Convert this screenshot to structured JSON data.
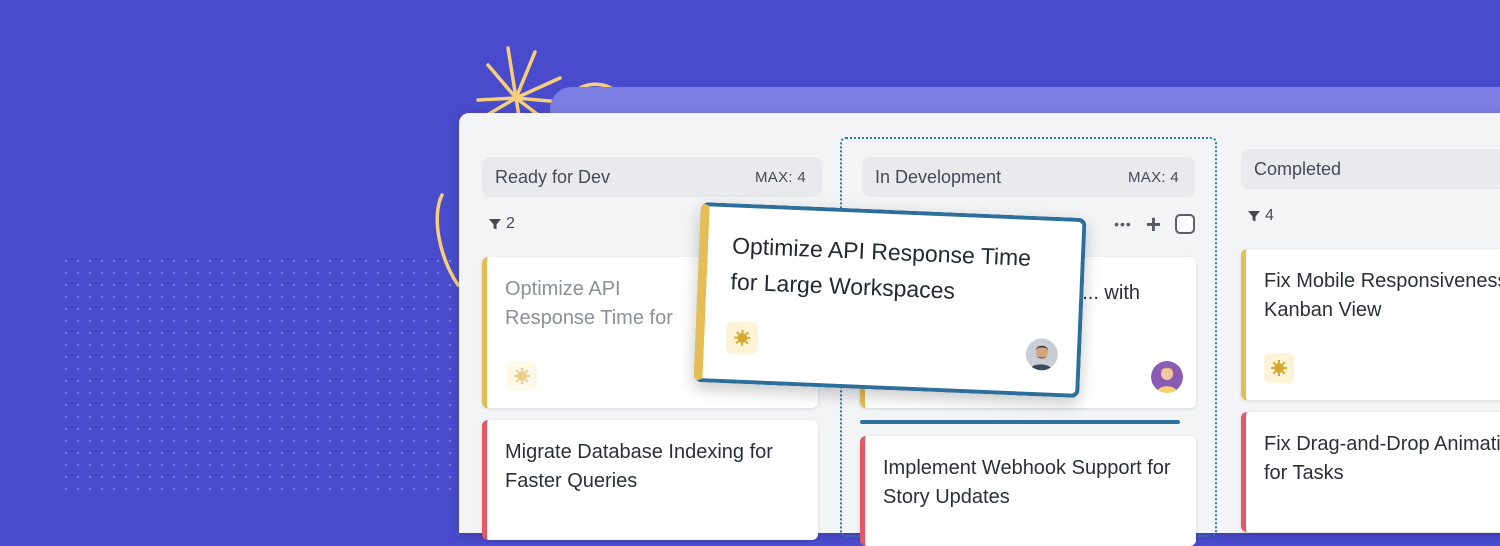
{
  "columns": [
    {
      "title": "Ready for Dev",
      "max": "MAX: 4",
      "filter_count": "2",
      "cards": [
        {
          "title": "Optimize API Response Time for Large Workspaces",
          "priority_icon": "sun-icon",
          "accent": "#e4bd56",
          "state": "placeholder"
        },
        {
          "title": "Migrate Database Indexing for Faster Queries",
          "accent": "#e35865"
        }
      ]
    },
    {
      "title": "In Development",
      "max": "MAX: 4",
      "tools": {
        "more": "•••",
        "add": "+"
      },
      "cards": [
        {
          "title": "... with",
          "accent": "#e4bd56"
        },
        {
          "title": "Implement Webhook Support for Story Updates",
          "accent": "#e35865"
        }
      ]
    },
    {
      "title": "Completed",
      "filter_count": "4",
      "tools": {
        "more": "••"
      },
      "cards": [
        {
          "title": "Fix Mobile Responsiveness in Kanban View",
          "priority_icon": "sun-icon",
          "accent": "#e4bd56"
        },
        {
          "title": "Fix Drag-and-Drop Animation for Tasks",
          "accent": "#e35865"
        }
      ]
    }
  ],
  "dragging_card": {
    "title": "Optimize API Response Time for Large Workspaces",
    "priority_icon": "sun-icon",
    "border_color": "#2c6f9a"
  },
  "colors": {
    "background": "#4a4bcc",
    "priority_medium": "#e4bd56",
    "priority_high": "#e35865",
    "drop_indicator": "#2f72a0"
  }
}
